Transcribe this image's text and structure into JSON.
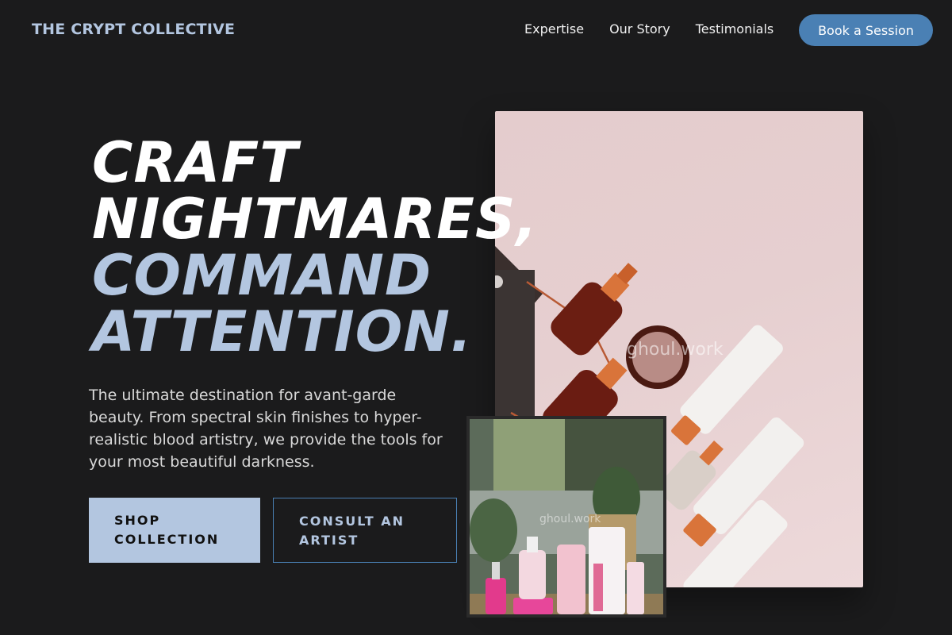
{
  "brand": {
    "name": "THE CRYPT COLLECTIVE"
  },
  "nav": {
    "links": [
      "Expertise",
      "Our Story",
      "Testimonials"
    ],
    "cta": "Book a Session"
  },
  "hero": {
    "headline": {
      "line1": "CRAFT",
      "line2": "NIGHTMARES,",
      "line3": "COMMAND",
      "line4": "ATTENTION."
    },
    "lead": "The ultimate destination for avant-garde beauty. From spectral skin finishes to hyper-realistic blood artistry, we provide the tools for your most beautiful darkness.",
    "primary_button": "SHOP COLLECTION",
    "secondary_button": "CONSULT AN ARTIST"
  },
  "images": {
    "main_watermark": "ghoul.work",
    "inset_watermark": "ghoul.work"
  },
  "colors": {
    "background": "#1b1b1c",
    "accent_light": "#b3c6e0",
    "accent_blue": "#4a80b4"
  }
}
